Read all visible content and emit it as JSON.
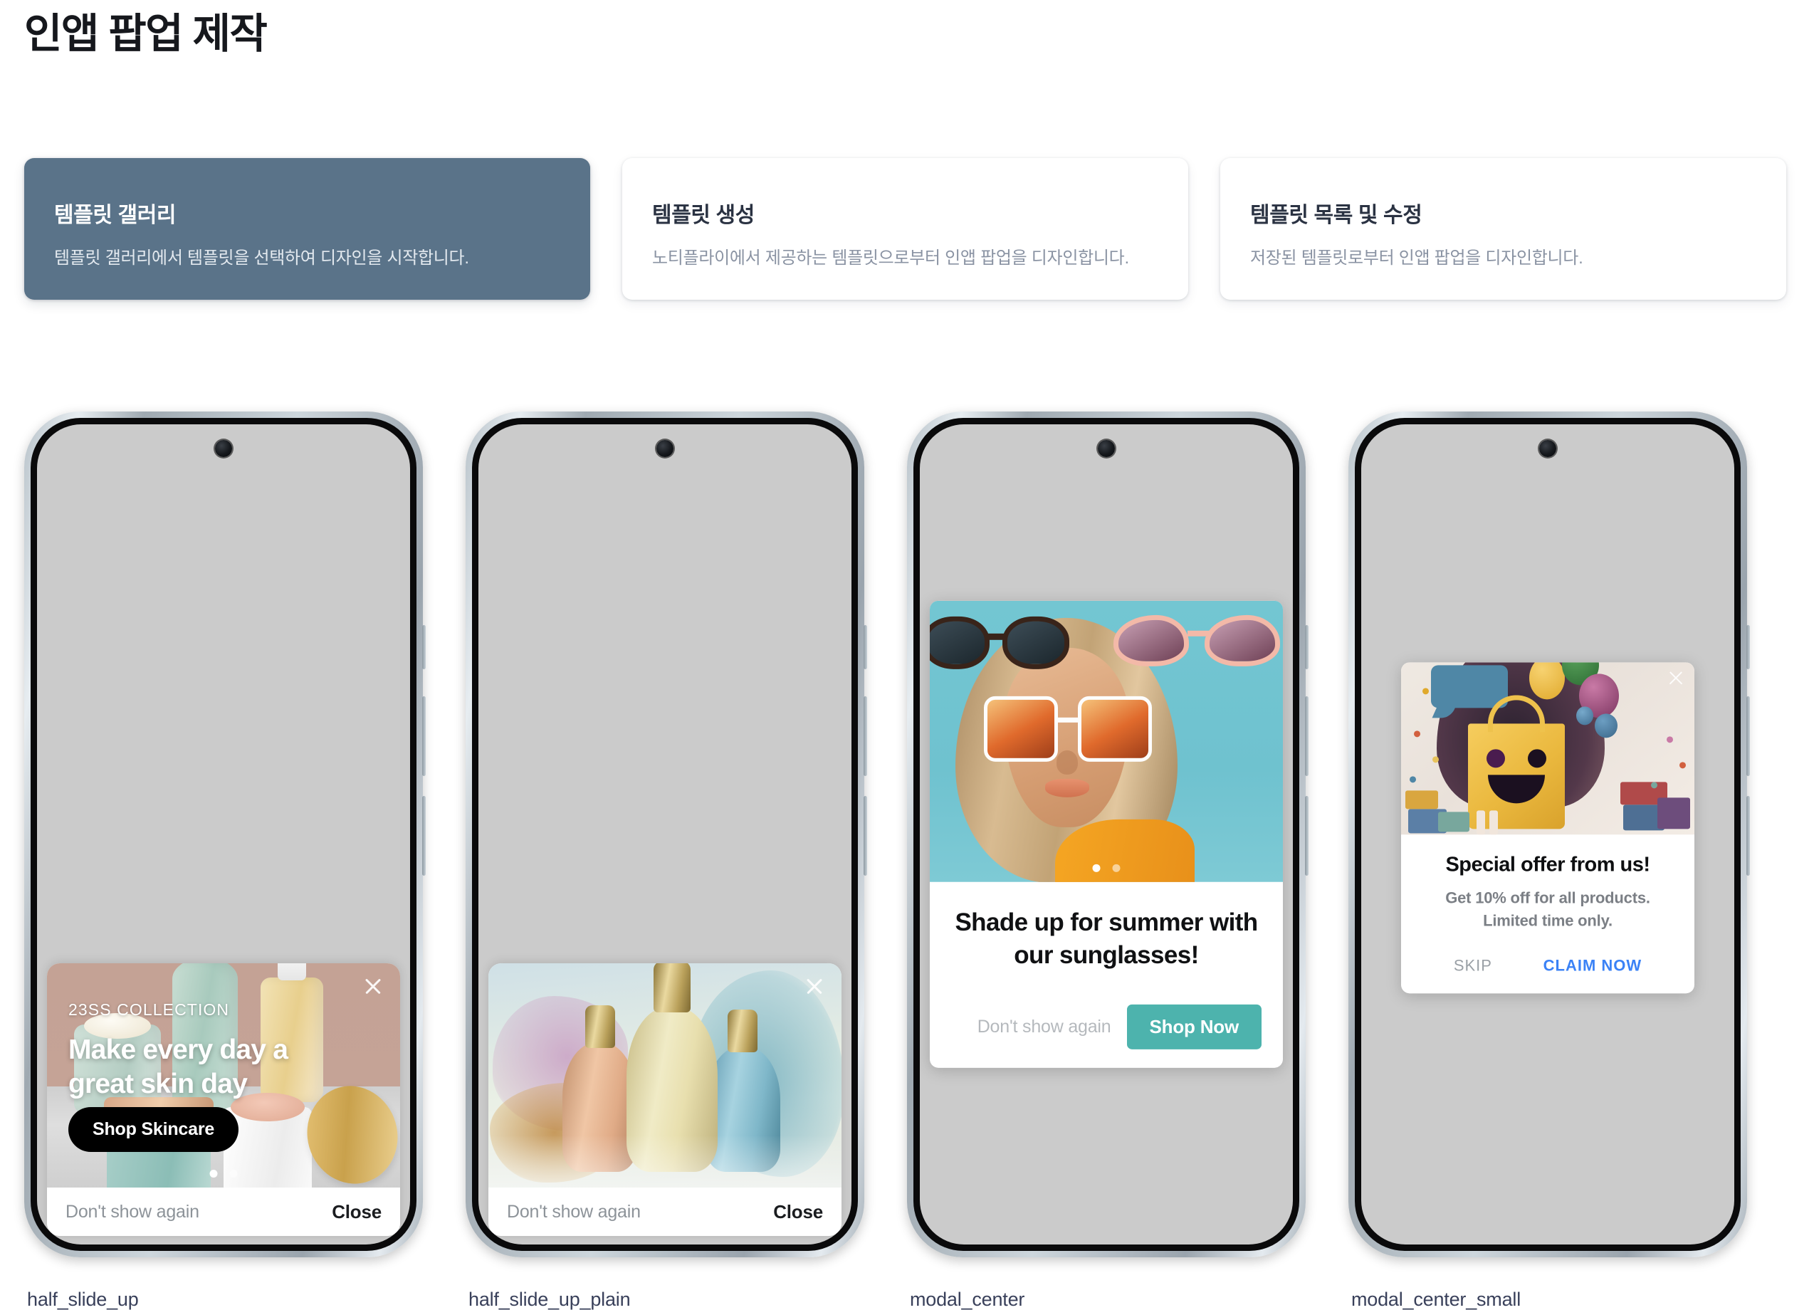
{
  "page": {
    "title": "인앱 팝업 제작"
  },
  "option_cards": [
    {
      "title": "템플릿 갤러리",
      "description": "템플릿 갤러리에서 템플릿을 선택하여 디자인을 시작합니다.",
      "selected": true
    },
    {
      "title": "템플릿 생성",
      "description": "노티플라이에서 제공하는 템플릿으로부터 인앱 팝업을 디자인합니다.",
      "selected": false
    },
    {
      "title": "템플릿 목록 및 수정",
      "description": "저장된 템플릿로부터 인앱 팝업을 디자인합니다.",
      "selected": false
    }
  ],
  "templates": [
    {
      "name": "half_slide_up",
      "type": "half-slide-up",
      "eyebrow": "23SS COLLECTION",
      "headline": "Make every day a great skin day",
      "cta": "Shop Skincare",
      "dont_show_again": "Don't show again",
      "close": "Close",
      "close_icon": "close-icon",
      "image_alt": "skincare-products-illustration",
      "carousel_dots": 2,
      "carousel_active_index": 0
    },
    {
      "name": "half_slide_up_plain",
      "type": "half-slide-up-plain",
      "dont_show_again": "Don't show again",
      "close": "Close",
      "close_icon": "close-icon",
      "image_alt": "perfume-bottles-illustration"
    },
    {
      "name": "modal_center",
      "type": "modal-center",
      "headline": "Shade up for summer with our sunglasses!",
      "dont_show_again": "Don't show again",
      "cta": "Shop Now",
      "cta_color": "#4db3ad",
      "image_alt": "woman-wearing-sunglasses-illustration",
      "carousel_dots": 2,
      "carousel_active_index": 0
    },
    {
      "name": "modal_center_small",
      "type": "modal-center-small",
      "headline": "Special offer from us!",
      "subtext_line1": "Get 10% off for all products.",
      "subtext_line2": "Limited time only.",
      "skip": "SKIP",
      "claim": "CLAIM NOW",
      "claim_color": "#3b82f6",
      "close_icon": "close-icon",
      "image_alt": "smiling-shopping-bag-with-balloons-illustration"
    }
  ],
  "colors": {
    "selected_card_bg": "#5a7389",
    "card_title": "#2a3242",
    "card_desc": "#8a93a3",
    "label_text": "#39405a",
    "screen_bg": "#cbcbcb",
    "teal_cta": "#4db3ad",
    "blue_link": "#3b82f6"
  }
}
